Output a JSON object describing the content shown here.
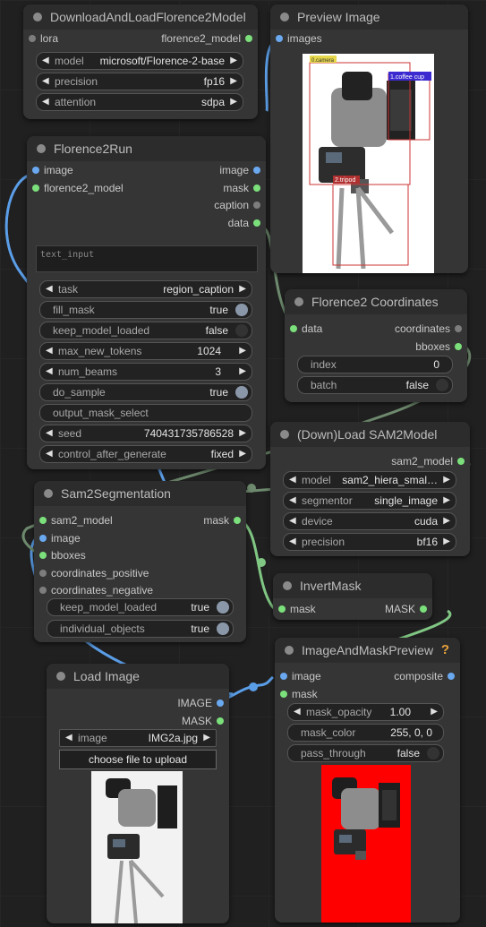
{
  "nodes": {
    "download_florence": {
      "title": "DownloadAndLoadFlorence2Model",
      "input_lora": "lora",
      "output_model": "florence2_model",
      "widgets": [
        {
          "label": "model",
          "value": "microsoft/Florence-2-base"
        },
        {
          "label": "precision",
          "value": "fp16"
        },
        {
          "label": "attention",
          "value": "sdpa"
        }
      ]
    },
    "preview_image": {
      "title": "Preview Image",
      "input_images": "images",
      "detections": [
        "0.camera",
        "1.coffee cup",
        "2.tripod"
      ]
    },
    "florence_run": {
      "title": "Florence2Run",
      "inputs": [
        "image",
        "florence2_model"
      ],
      "outputs": [
        "image",
        "mask",
        "caption",
        "data"
      ],
      "text_input_placeholder": "text_input",
      "widgets": {
        "task": {
          "label": "task",
          "value": "region_caption"
        },
        "fill_mask": {
          "label": "fill_mask",
          "value": "true"
        },
        "keep_model_loaded": {
          "label": "keep_model_loaded",
          "value": "false"
        },
        "max_new_tokens": {
          "label": "max_new_tokens",
          "value": "1024"
        },
        "num_beams": {
          "label": "num_beams",
          "value": "3"
        },
        "do_sample": {
          "label": "do_sample",
          "value": "true"
        },
        "output_mask_select": {
          "label": "output_mask_select"
        },
        "seed": {
          "label": "seed",
          "value": "740431735786528"
        },
        "control_after_generate": {
          "label": "control_after_generate",
          "value": "fixed"
        }
      }
    },
    "florence_coords": {
      "title": "Florence2 Coordinates",
      "input_data": "data",
      "outputs": [
        "coordinates",
        "bboxes"
      ],
      "index": {
        "label": "index",
        "value": "0"
      },
      "batch": {
        "label": "batch",
        "value": "false"
      }
    },
    "load_sam2": {
      "title": "(Down)Load SAM2Model",
      "output": "sam2_model",
      "widgets": [
        {
          "label": "model",
          "value": "sam2_hiera_smal…"
        },
        {
          "label": "segmentor",
          "value": "single_image"
        },
        {
          "label": "device",
          "value": "cuda"
        },
        {
          "label": "precision",
          "value": "bf16"
        }
      ]
    },
    "sam2_seg": {
      "title": "Sam2Segmentation",
      "inputs": [
        "sam2_model",
        "image",
        "bboxes",
        "coordinates_positive",
        "coordinates_negative"
      ],
      "output": "mask",
      "keep_model_loaded": {
        "label": "keep_model_loaded",
        "value": "true"
      },
      "individual_objects": {
        "label": "individual_objects",
        "value": "true"
      }
    },
    "invert_mask": {
      "title": "InvertMask",
      "input": "mask",
      "output": "MASK"
    },
    "image_mask_preview": {
      "title": "ImageAndMaskPreview",
      "help": "?",
      "inputs": [
        "image",
        "mask"
      ],
      "output": "composite",
      "mask_opacity": {
        "label": "mask_opacity",
        "value": "1.00"
      },
      "mask_color": {
        "label": "mask_color",
        "value": "255, 0, 0"
      },
      "pass_through": {
        "label": "pass_through",
        "value": "false"
      }
    },
    "load_image": {
      "title": "Load Image",
      "outputs": [
        "IMAGE",
        "MASK"
      ],
      "image": {
        "label": "image",
        "value": "IMG2a.jpg"
      },
      "upload_label": "choose file to upload"
    }
  },
  "colors": {
    "image_wire": "#5b9ee8",
    "mask_wire": "#81c784",
    "data_wire": "#6e8a6e",
    "mask_fill": "#ff0000"
  }
}
